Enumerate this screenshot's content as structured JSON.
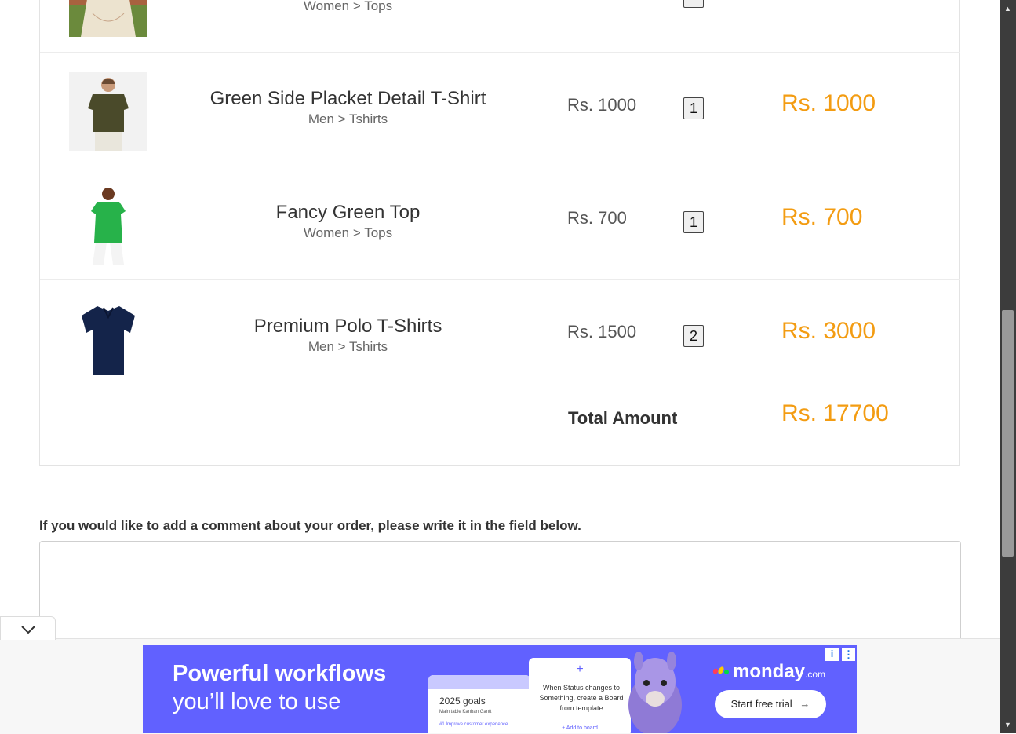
{
  "cart": {
    "partial_row": {
      "category": "Women > Tops"
    },
    "items": [
      {
        "name": "Green Side Placket Detail T-Shirt",
        "category": "Men > Tshirts",
        "price": "Rs. 1000",
        "qty": "1",
        "subtotal": "Rs. 1000"
      },
      {
        "name": "Fancy Green Top",
        "category": "Women > Tops",
        "price": "Rs. 700",
        "qty": "1",
        "subtotal": "Rs. 700"
      },
      {
        "name": "Premium Polo T-Shirts",
        "category": "Men > Tshirts",
        "price": "Rs. 1500",
        "qty": "2",
        "subtotal": "Rs. 3000"
      }
    ],
    "total_label": "Total Amount",
    "total_value": "Rs. 17700"
  },
  "comment": {
    "label": "If you would like to add a comment about your order, please write it in the field below.",
    "value": ""
  },
  "ad": {
    "headline1": "Powerful workflows",
    "headline2": "you’ll love to use",
    "card1_title": "2025 goals",
    "card1_tabs": "Main table   Kanban   Gantt",
    "card1_item": "#1 Improve customer experience",
    "card2_text": "When Status changes to Something, create a Board from template",
    "card2_link": "+ Add to board",
    "brand": "monday",
    "brand_suffix": ".com",
    "cta": "Start free trial",
    "accent_color": "#6161ff"
  },
  "colors": {
    "subtotal": "#f39c12",
    "scrollbar": "#3c3c3c"
  }
}
